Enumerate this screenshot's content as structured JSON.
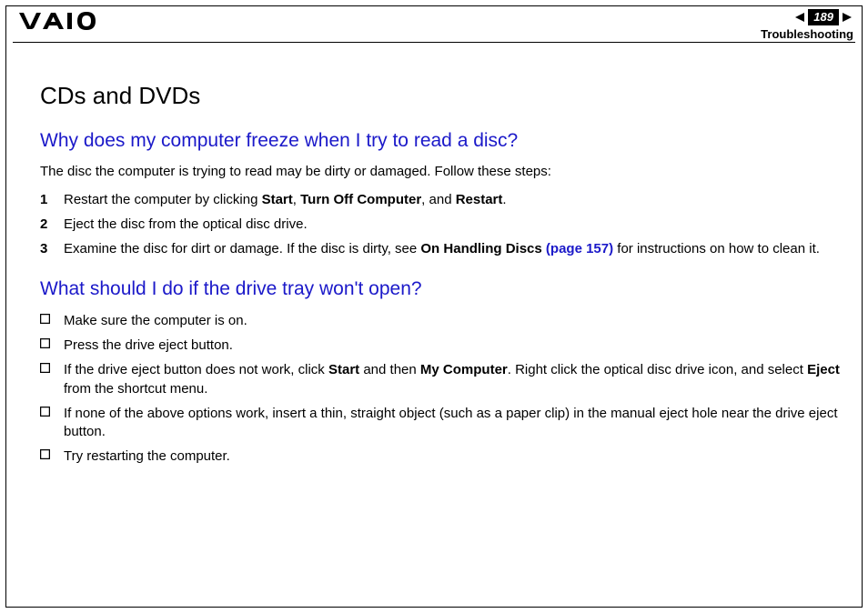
{
  "header": {
    "page_number": "189",
    "section": "Troubleshooting"
  },
  "content": {
    "title": "CDs and DVDs",
    "q1": {
      "heading": "Why does my computer freeze when I try to read a disc?",
      "intro": "The disc the computer is trying to read may be dirty or damaged. Follow these steps:",
      "steps": [
        {
          "num": "1",
          "pre": "Restart the computer by clicking ",
          "b1": "Start",
          "s1": ", ",
          "b2": "Turn Off Computer",
          "s2": ", and ",
          "b3": "Restart",
          "post": "."
        },
        {
          "num": "2",
          "text": "Eject the disc from the optical disc drive."
        },
        {
          "num": "3",
          "pre": "Examine the disc for dirt or damage. If the disc is dirty, see ",
          "b1": "On Handling Discs ",
          "link": "(page 157)",
          "post": " for instructions on how to clean it."
        }
      ]
    },
    "q2": {
      "heading": "What should I do if the drive tray won't open?",
      "bullets": [
        {
          "text": "Make sure the computer is on."
        },
        {
          "text": "Press the drive eject button."
        },
        {
          "pre": "If the drive eject button does not work, click ",
          "b1": "Start",
          "s1": " and then ",
          "b2": "My Computer",
          "s2": ". Right click the optical disc drive icon, and select ",
          "b3": "Eject",
          "post": " from the shortcut menu."
        },
        {
          "text": "If none of the above options work, insert a thin, straight object (such as a paper clip) in the manual eject hole near the drive eject button."
        },
        {
          "text": "Try restarting the computer."
        }
      ]
    }
  }
}
